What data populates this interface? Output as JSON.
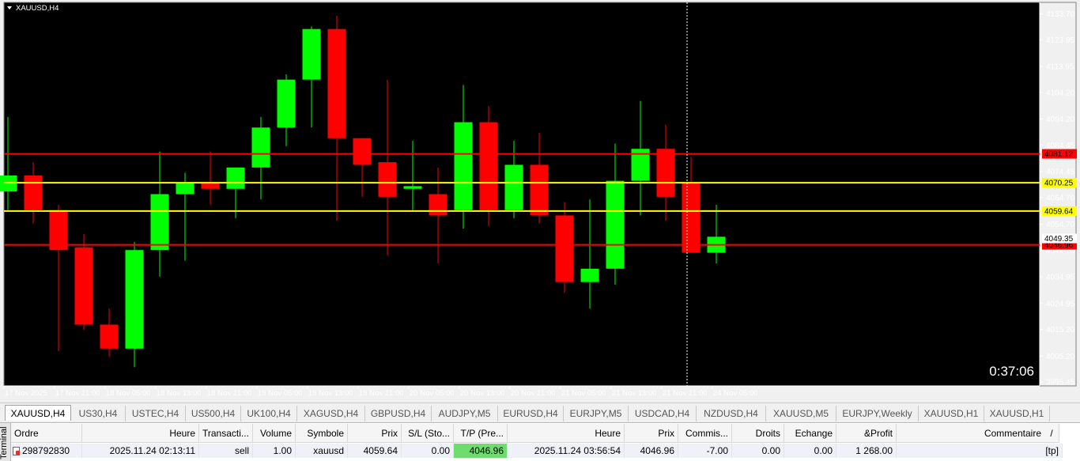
{
  "chart": {
    "symbol_label": "XAUUSD,H4",
    "countdown": "0:37:06",
    "colors": {
      "background": "#000000",
      "bull": "#00ff00",
      "bear": "#ff0000",
      "support_resistance_red": "#ff0000",
      "support_resistance_yellow": "#ffff00",
      "axis": "#ffffff"
    }
  },
  "chart_data": {
    "type": "candlestick",
    "price_axis_ticks": [
      "4133.70",
      "4123.95",
      "4113.95",
      "4104.20",
      "4094.20",
      "4084.45",
      "4074.45",
      "4064.70",
      "4054.70",
      "4044.70",
      "4034.95",
      "4024.95",
      "4015.20",
      "4005.20",
      "3995.45"
    ],
    "time_axis_labels": [
      "17 Nov 2025",
      "17 Nov 21:00",
      "18 Nov 05:00",
      "18 Nov 13:00",
      "18 Nov 21:00",
      "19 Nov 05:00",
      "19 Nov 13:00",
      "19 Nov 21:00",
      "20 Nov 05:00",
      "20 Nov 13:00",
      "20 Nov 21:00",
      "21 Nov 05:00",
      "21 Nov 13:00",
      "21 Nov 21:00",
      "24 Nov 05:00"
    ],
    "ylim": [
      3994,
      4138
    ],
    "candles": [
      {
        "o": 4067,
        "h": 4095,
        "l": 4060,
        "c": 4073
      },
      {
        "o": 4073,
        "h": 4078,
        "l": 4055,
        "c": 4060
      },
      {
        "o": 4060,
        "h": 4062,
        "l": 4007,
        "c": 4045
      },
      {
        "o": 4046,
        "h": 4051,
        "l": 4015,
        "c": 4017
      },
      {
        "o": 4017,
        "h": 4023,
        "l": 4005,
        "c": 4008
      },
      {
        "o": 4008,
        "h": 4048,
        "l": 4001,
        "c": 4045
      },
      {
        "o": 4045,
        "h": 4082,
        "l": 4035,
        "c": 4066
      },
      {
        "o": 4066,
        "h": 4074,
        "l": 4041,
        "c": 4070
      },
      {
        "o": 4070,
        "h": 4082,
        "l": 4062,
        "c": 4068
      },
      {
        "o": 4068,
        "h": 4076,
        "l": 4057,
        "c": 4076
      },
      {
        "o": 4076,
        "h": 4095,
        "l": 4064,
        "c": 4091
      },
      {
        "o": 4091,
        "h": 4111,
        "l": 4084,
        "c": 4109
      },
      {
        "o": 4109,
        "h": 4129,
        "l": 4091,
        "c": 4128
      },
      {
        "o": 4128,
        "h": 4133,
        "l": 4056,
        "c": 4087
      },
      {
        "o": 4087,
        "h": 4087,
        "l": 4065,
        "c": 4077
      },
      {
        "o": 4078,
        "h": 4109,
        "l": 4043,
        "c": 4065
      },
      {
        "o": 4068,
        "h": 4086,
        "l": 4060,
        "c": 4069
      },
      {
        "o": 4066,
        "h": 4076,
        "l": 4040,
        "c": 4058
      },
      {
        "o": 4060,
        "h": 4107,
        "l": 4053,
        "c": 4093
      },
      {
        "o": 4093,
        "h": 4099,
        "l": 4054,
        "c": 4060
      },
      {
        "o": 4060,
        "h": 4086,
        "l": 4057,
        "c": 4077
      },
      {
        "o": 4077,
        "h": 4089,
        "l": 4055,
        "c": 4058
      },
      {
        "o": 4058,
        "h": 4063,
        "l": 4029,
        "c": 4033
      },
      {
        "o": 4033,
        "h": 4064,
        "l": 4023,
        "c": 4038
      },
      {
        "o": 4038,
        "h": 4085,
        "l": 4032,
        "c": 4071
      },
      {
        "o": 4071,
        "h": 4101,
        "l": 4058,
        "c": 4083
      },
      {
        "o": 4083,
        "h": 4092,
        "l": 4056,
        "c": 4065
      },
      {
        "o": 4070,
        "h": 4080,
        "l": 4044,
        "c": 4044
      },
      {
        "o": 4044,
        "h": 4062,
        "l": 4040,
        "c": 4050
      }
    ],
    "levels": [
      {
        "price": 4081.12,
        "label": "4081.12",
        "color": "#ff0000"
      },
      {
        "price": 4070.25,
        "label": "4070.25",
        "color": "#ffff00"
      },
      {
        "price": 4059.64,
        "label": "4059.64",
        "color": "#ffff00"
      },
      {
        "price": 4046.96,
        "label": "4046.96",
        "color": "#ff0000"
      }
    ],
    "bid_label": "4049.35"
  },
  "tabs": [
    "XAUUSD,H4",
    "US30,H4",
    "USTEC,H4",
    "US500,H4",
    "UK100,H4",
    "XAGUSD,H4",
    "GBPUSD,H4",
    "AUDJPY,M5",
    "EURUSD,H4",
    "EURJPY,M5",
    "USDCAD,H4",
    "NZDUSD,H4",
    "XAUUSD,M5",
    "EURJPY,Weekly",
    "XAUUSD,H1",
    "XAUUSD,H1"
  ],
  "terminal": {
    "side_label": "Terminal",
    "headers": [
      "Ordre",
      "Heure",
      "Transacti...",
      "Volume",
      "Symbole",
      "Prix",
      "S/L (Sto...",
      "T/P (Pre...",
      "Heure",
      "Prix",
      "Commis...",
      "Droits",
      "Echange",
      "&Profit",
      "Commentaire"
    ],
    "row": [
      "298792830",
      "2025.11.24 02:13:11",
      "sell",
      "1.00",
      "xauusd",
      "4059.64",
      "0.00",
      "4046.96",
      "2025.11.24 03:56:54",
      "4046.96",
      "-7.00",
      "0.00",
      "0.00",
      "1 268.00",
      "[tp]"
    ],
    "sort_arrow": "/"
  }
}
